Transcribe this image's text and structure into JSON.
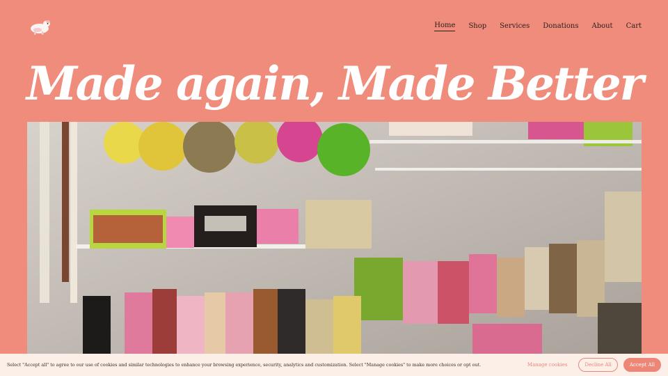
{
  "brand": {
    "logo_icon": "lamb-icon"
  },
  "nav": {
    "items": [
      {
        "label": "Home",
        "active": true
      },
      {
        "label": "Shop"
      },
      {
        "label": "Services"
      },
      {
        "label": "Donations"
      },
      {
        "label": "About"
      },
      {
        "label": "Cart"
      }
    ]
  },
  "hero": {
    "title": "Made again, Made Better",
    "image_icon": "closet-handbags-photo"
  },
  "cookie": {
    "text": "Select \"Accept all\" to agree to our use of cookies and similar technologies to enhance your browsing experience, security, analytics and customization. Select \"Manage cookies\" to make more choices or opt out.",
    "manage_label": "Manage cookies",
    "decline_label": "Decline All",
    "accept_label": "Accept All"
  },
  "colors": {
    "background": "#f08c7b",
    "title": "#ffffff",
    "cookie_bar": "#fcefe7",
    "accent": "#ec8677"
  }
}
